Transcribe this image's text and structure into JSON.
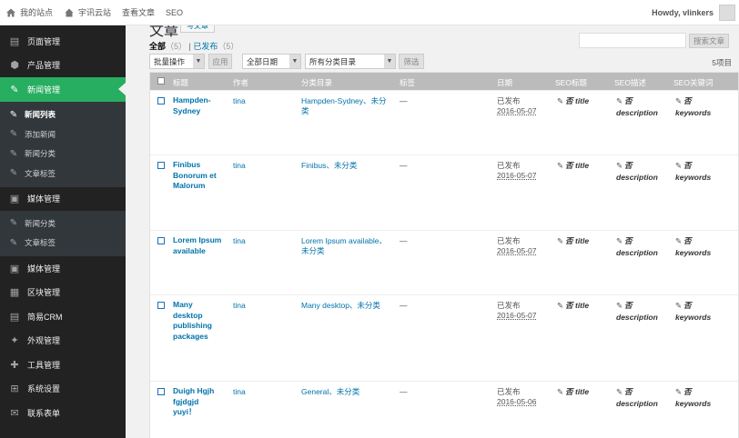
{
  "adminbar": {
    "site_name": "我的站点",
    "cloud_site": "宇讯云站",
    "view_posts": "查看文章",
    "seo": "SEO",
    "howdy": "Howdy, vlinkers"
  },
  "sidebar": {
    "items": [
      {
        "label": "页面管理",
        "icon": "pages-icon"
      },
      {
        "label": "产品管理",
        "icon": "products-icon"
      },
      {
        "label": "新闻管理",
        "icon": "pin-icon",
        "current": true
      }
    ],
    "submenu": [
      {
        "label": "新闻列表",
        "current": true
      },
      {
        "label": "添加新闻"
      },
      {
        "label": "新闻分类"
      },
      {
        "label": "文章标签"
      }
    ],
    "items2": [
      {
        "label": "媒体管理",
        "icon": "media-icon"
      }
    ],
    "submenu2": [
      {
        "label": "新闻分类"
      },
      {
        "label": "文章标签"
      }
    ],
    "items3": [
      {
        "label": "媒体管理",
        "icon": "media-icon"
      },
      {
        "label": "区块管理",
        "icon": "block-icon"
      },
      {
        "label": "简易CRM",
        "icon": "crm-icon"
      },
      {
        "label": "外观管理",
        "icon": "appearance-icon"
      },
      {
        "label": "工具管理",
        "icon": "tools-icon"
      },
      {
        "label": "系统设置",
        "icon": "settings-icon"
      },
      {
        "label": "联系表单",
        "icon": "mail-icon"
      }
    ]
  },
  "page": {
    "title": "文章",
    "add_new": "写文章",
    "filters": {
      "all_label": "全部",
      "all_count": "（5）",
      "sep": "|",
      "published_label": "已发布",
      "published_count": "（5）"
    },
    "search_button": "搜索文章",
    "bulk_action": "批量操作",
    "apply": "应用",
    "all_dates": "全部日期",
    "all_categories": "所有分类目录",
    "filter": "筛选",
    "items_count": "5项目"
  },
  "table": {
    "headers": {
      "title": "标题",
      "author": "作者",
      "categories": "分类目录",
      "tags": "标签",
      "date": "日期",
      "seo_title": "SEO标题",
      "seo_desc": "SEO描述",
      "seo_keywords": "SEO关键词"
    },
    "rows": [
      {
        "title": "Hampden-Sydney",
        "author": "tina",
        "cat": "Hampden-Sydney、未分类",
        "tags": "—",
        "status": "已发布",
        "date": "2016-05-07",
        "seo_title": "否 title",
        "seo_desc": "否 description",
        "seo_kw": "否 keywords"
      },
      {
        "title": "Finibus Bonorum et Malorum",
        "author": "tina",
        "cat": "Finibus、未分类",
        "tags": "—",
        "status": "已发布",
        "date": "2016-05-07",
        "seo_title": "否 title",
        "seo_desc": "否 description",
        "seo_kw": "否 keywords"
      },
      {
        "title": "Lorem Ipsum available",
        "author": "tina",
        "cat": "Lorem Ipsum available、未分类",
        "tags": "—",
        "status": "已发布",
        "date": "2016-05-07",
        "seo_title": "否 title",
        "seo_desc": "否 description",
        "seo_kw": "否 keywords"
      },
      {
        "title": "Many desktop publishing packages",
        "author": "tina",
        "cat": "Many desktop、未分类",
        "tags": "—",
        "status": "已发布",
        "date": "2016-05-07",
        "seo_title": "否 title",
        "seo_desc": "否 description",
        "seo_kw": "否 keywords"
      },
      {
        "title": "Duigh Hgjh fgjdgjd yuyi！",
        "author": "tina",
        "cat": "General、未分类",
        "tags": "—",
        "status": "已发布",
        "date": "2016-05-06",
        "seo_title": "否 title",
        "seo_desc": "否 description",
        "seo_kw": "否 keywords"
      }
    ]
  },
  "colors": {
    "accent": "#27ae60",
    "link": "#0073aa",
    "sidebar": "#222222"
  }
}
